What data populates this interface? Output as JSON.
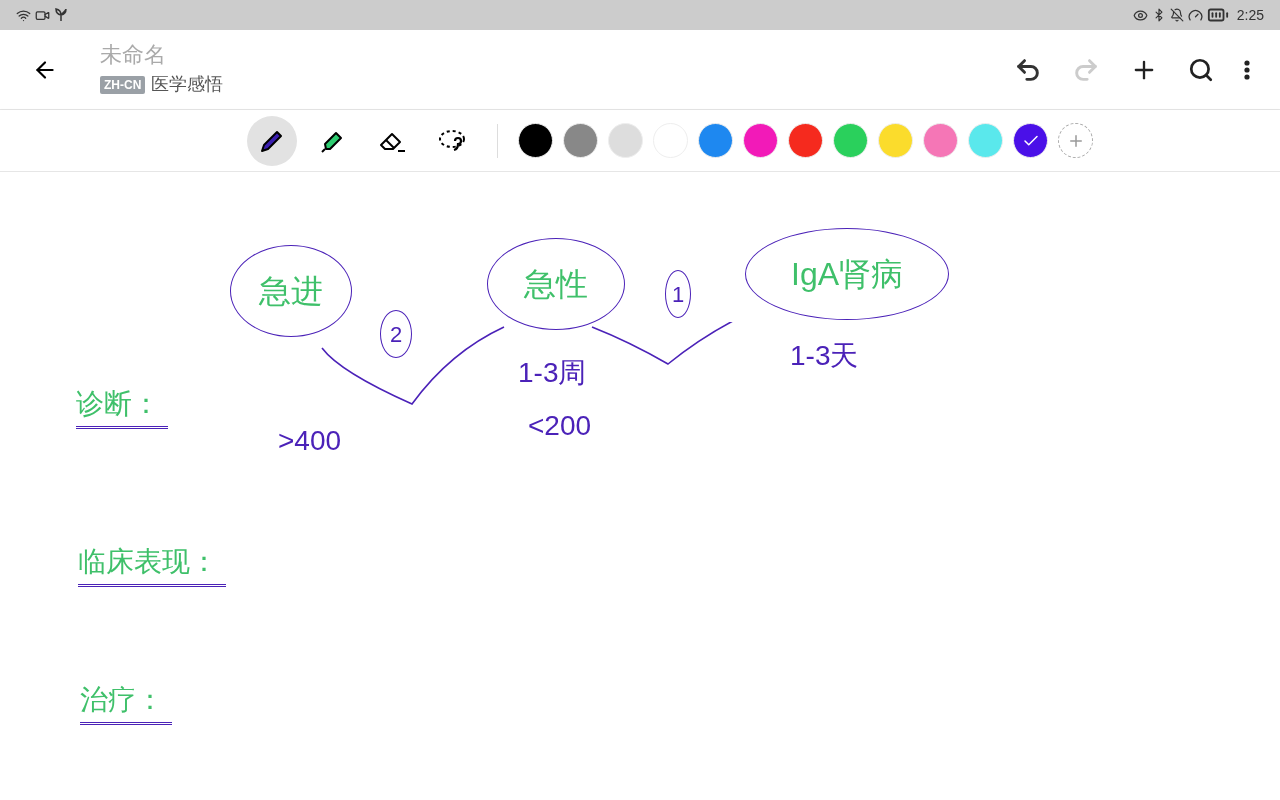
{
  "status_bar": {
    "time": "2:25"
  },
  "header": {
    "title": "未命名",
    "language_tag": "ZH-CN",
    "notebook": "医学感悟",
    "undo_disabled": false,
    "redo_disabled": true
  },
  "tools": [
    {
      "kind": "pen",
      "selected": true
    },
    {
      "kind": "highlighter",
      "selected": false
    },
    {
      "kind": "eraser",
      "selected": false
    },
    {
      "kind": "lasso",
      "selected": false
    }
  ],
  "palette": [
    {
      "color": "#000000",
      "selected": false
    },
    {
      "color": "#888888",
      "selected": false
    },
    {
      "color": "#dddddd",
      "selected": false
    },
    {
      "color": "#ffffff",
      "selected": false
    },
    {
      "color": "#1e88f0",
      "selected": false
    },
    {
      "color": "#f21ab8",
      "selected": false
    },
    {
      "color": "#f52a1e",
      "selected": false
    },
    {
      "color": "#2ad05c",
      "selected": false
    },
    {
      "color": "#fbdc2c",
      "selected": false
    },
    {
      "color": "#f576b6",
      "selected": false
    },
    {
      "color": "#5ae8ec",
      "selected": false
    },
    {
      "color": "#4a10e8",
      "selected": true
    }
  ],
  "ink_notes": [
    {
      "text": "急进",
      "color": "#3fc06a",
      "kind": "circled"
    },
    {
      "text": "2",
      "color": "#4b22b8",
      "kind": "circled"
    },
    {
      "text": "急性",
      "color": "#3fc06a",
      "kind": "circled"
    },
    {
      "text": "1",
      "color": "#4b22b8",
      "kind": "circled"
    },
    {
      "text": "IgA肾病",
      "color": "#3fc06a",
      "kind": "circled"
    },
    {
      "text": "1-3周",
      "color": "#4b22b8",
      "kind": "plain"
    },
    {
      "text": "<200",
      "color": "#4b22b8",
      "kind": "plain"
    },
    {
      "text": "1-3天",
      "color": "#4b22b8",
      "kind": "plain"
    },
    {
      "text": ">400",
      "color": "#4b22b8",
      "kind": "plain"
    },
    {
      "text": "诊断：",
      "color": "#3fc06a",
      "kind": "underlined"
    },
    {
      "text": "临床表现：",
      "color": "#3fc06a",
      "kind": "underlined"
    },
    {
      "text": "治疗：",
      "color": "#3fc06a",
      "kind": "underlined"
    }
  ]
}
